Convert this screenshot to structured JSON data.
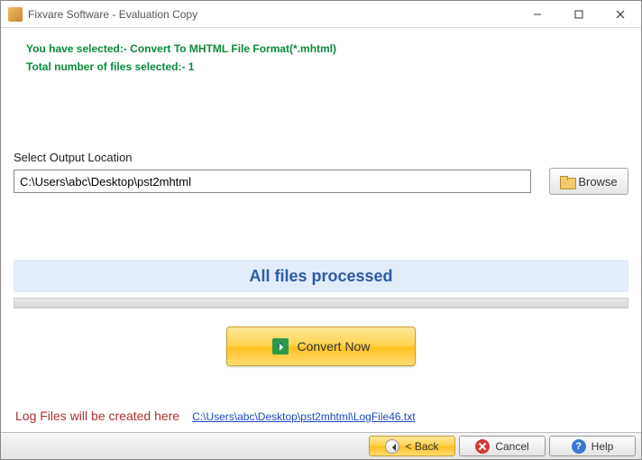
{
  "window": {
    "title": "Fixvare Software - Evaluation Copy"
  },
  "info": {
    "selected_format": "You have selected:- Convert To MHTML File Format(*.mhtml)",
    "file_count": "Total number of files selected:- 1"
  },
  "output": {
    "label": "Select Output Location",
    "path": "C:\\Users\\abc\\Desktop\\pst2mhtml",
    "browse_label": "Browse"
  },
  "status": {
    "text": "All files processed"
  },
  "convert": {
    "label": "Convert Now"
  },
  "log": {
    "label": "Log Files will be created here",
    "link": "C:\\Users\\abc\\Desktop\\pst2mhtml\\LogFile46.txt"
  },
  "footer": {
    "back": "< Back",
    "cancel": "Cancel",
    "help": "Help"
  }
}
